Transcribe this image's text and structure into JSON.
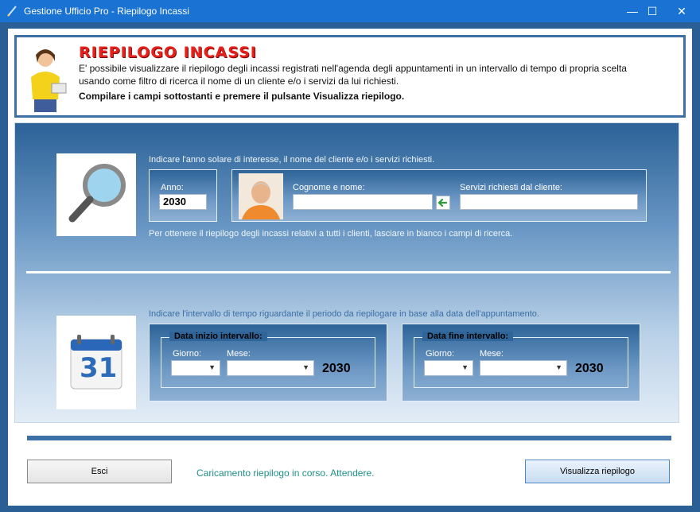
{
  "window": {
    "title": "Gestione Ufficio Pro - Riepilogo Incassi",
    "controls": {
      "minimize": "—",
      "maximize": "☐",
      "close": "✕"
    }
  },
  "header": {
    "title": "RIEPILOGO INCASSI",
    "description": "E' possibile visualizzare il riepilogo degli incassi registrati nell'agenda degli appuntamenti in un intervallo di tempo di propria scelta usando come filtro di ricerca il nome di un cliente e/o i servizi da lui richiesti.",
    "instruction": "Compilare  i campi sottostanti e premere il pulsante Visualizza riepilogo."
  },
  "search": {
    "intro": "Indicare l'anno solare di interesse, il nome del cliente e/o i servizi richiesti.",
    "anno_label": "Anno:",
    "anno_value": "2030",
    "cliente_label": "Cognome e nome:",
    "cliente_value": "",
    "servizi_label": "Servizi richiesti dal cliente:",
    "servizi_value": "",
    "hint": "Per ottenere il riepilogo degli incassi relativi a tutti i clienti, lasciare in bianco i campi di ricerca."
  },
  "interval": {
    "intro": "Indicare l'intervallo di tempo riguardante il periodo da riepilogare in base alla data dell'appuntamento.",
    "start": {
      "legend": "Data inizio intervallo:",
      "giorno_label": "Giorno:",
      "mese_label": "Mese:",
      "giorno_value": "",
      "mese_value": "",
      "year": "2030"
    },
    "end": {
      "legend": "Data fine intervallo:",
      "giorno_label": "Giorno:",
      "mese_label": "Mese:",
      "giorno_value": "",
      "mese_value": "",
      "year": "2030"
    },
    "calendar_day": "31"
  },
  "footer": {
    "exit_label": "Esci",
    "status": "Caricamento riepilogo in corso. Attendere.",
    "view_label": "Visualizza riepilogo"
  },
  "colors": {
    "titlebar": "#1a73d2",
    "accent": "#3b6fa5",
    "header_title": "#e8201b",
    "status": "#1f8f87"
  }
}
